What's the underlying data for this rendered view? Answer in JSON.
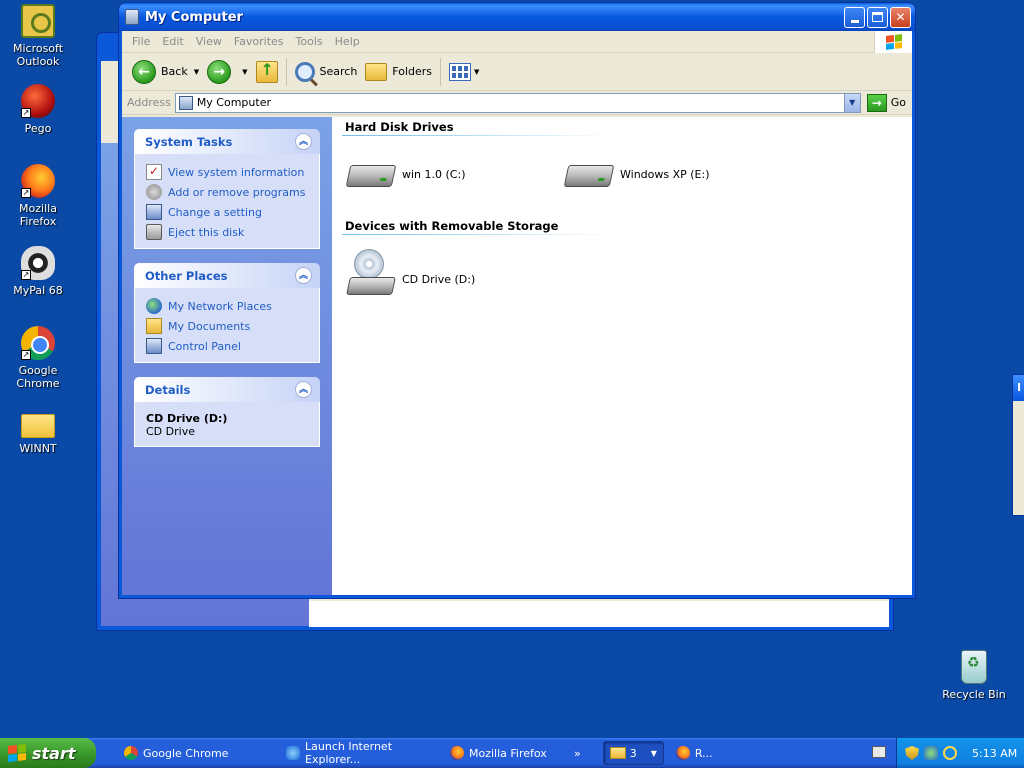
{
  "desktop": {
    "icons": [
      {
        "label": "Microsoft Outlook",
        "icon": "outlook-icon"
      },
      {
        "label": "Pego",
        "icon": "pego-icon"
      },
      {
        "label": "Mozilla Firefox",
        "icon": "firefox-icon"
      },
      {
        "label": "MyPal 68",
        "icon": "mypal-icon"
      },
      {
        "label": "Google Chrome",
        "icon": "chrome-icon"
      },
      {
        "label": "WINNT",
        "icon": "folder-icon"
      },
      {
        "label": "Recycle Bin",
        "icon": "recycle-bin-icon"
      }
    ]
  },
  "window": {
    "title": "My Computer",
    "menu": [
      "File",
      "Edit",
      "View",
      "Favorites",
      "Tools",
      "Help"
    ],
    "toolbar": {
      "back": "Back",
      "search": "Search",
      "folders": "Folders"
    },
    "address": {
      "label": "Address",
      "value": "My Computer",
      "go": "Go"
    },
    "panels": {
      "system_tasks": {
        "title": "System Tasks",
        "items": [
          "View system information",
          "Add or remove programs",
          "Change a setting",
          "Eject this disk"
        ]
      },
      "other_places": {
        "title": "Other Places",
        "items": [
          "My Network Places",
          "My Documents",
          "Control Panel"
        ]
      },
      "details": {
        "title": "Details",
        "name": "CD Drive (D:)",
        "type": "CD Drive"
      }
    },
    "groups": {
      "hard_disks": {
        "title": "Hard Disk Drives",
        "drives": [
          "win 1.0 (C:)",
          "Windows XP (E:)"
        ]
      },
      "removable": {
        "title": "Devices with Removable Storage",
        "drives": [
          "CD Drive (D:)"
        ]
      }
    }
  },
  "taskbar": {
    "start": "start",
    "tasks": [
      {
        "label": "Google Chrome",
        "icon": "chrome-icon"
      },
      {
        "label": "Launch Internet Explorer...",
        "icon": "ie-icon"
      },
      {
        "label": "Mozilla Firefox",
        "icon": "firefox-icon"
      }
    ],
    "overflow": "»",
    "group_count": "3",
    "group_label": "R...",
    "clock": "5:13 AM"
  },
  "colors": {
    "desktop": "#0a4aa6",
    "titlebar": "#0858e0",
    "taskpane_link": "#215dc6",
    "start_green": "#3a9a2a"
  }
}
